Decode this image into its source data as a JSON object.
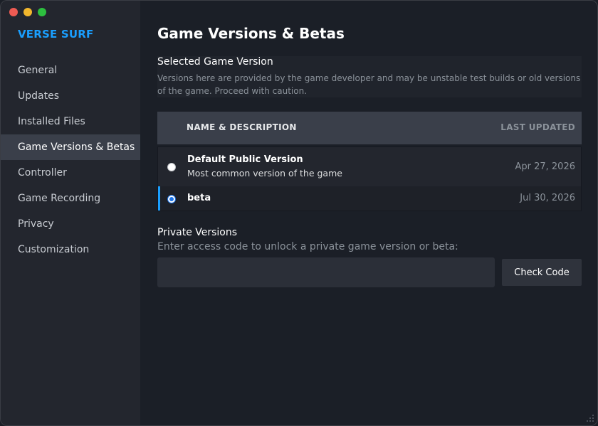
{
  "window": {
    "controls": [
      "close",
      "minimize",
      "zoom"
    ]
  },
  "sidebar": {
    "game_title": "VERSE SURF",
    "items": [
      {
        "label": "General",
        "active": false
      },
      {
        "label": "Updates",
        "active": false
      },
      {
        "label": "Installed Files",
        "active": false
      },
      {
        "label": "Game Versions & Betas",
        "active": true
      },
      {
        "label": "Controller",
        "active": false
      },
      {
        "label": "Game Recording",
        "active": false
      },
      {
        "label": "Privacy",
        "active": false
      },
      {
        "label": "Customization",
        "active": false
      }
    ]
  },
  "main": {
    "title": "Game Versions & Betas",
    "selected_section": {
      "title": "Selected Game Version",
      "description": "Versions here are provided by the game developer and may be unstable test builds or old versions of the game. Proceed with caution."
    },
    "table": {
      "col_name": "NAME & DESCRIPTION",
      "col_updated": "LAST UPDATED",
      "rows": [
        {
          "name": "Default Public Version",
          "description": "Most common version of the game",
          "date": "Apr 27, 2026",
          "selected": false
        },
        {
          "name": "beta",
          "description": "",
          "date": "Jul 30, 2026",
          "selected": true
        }
      ]
    },
    "private": {
      "title": "Private Versions",
      "description": "Enter access code to unlock a private game version or beta:",
      "input_value": "",
      "input_placeholder": "",
      "button_label": "Check Code"
    }
  },
  "colors": {
    "accent": "#1a9fff",
    "background": "#1b1f27",
    "sidebar": "#23262e"
  }
}
